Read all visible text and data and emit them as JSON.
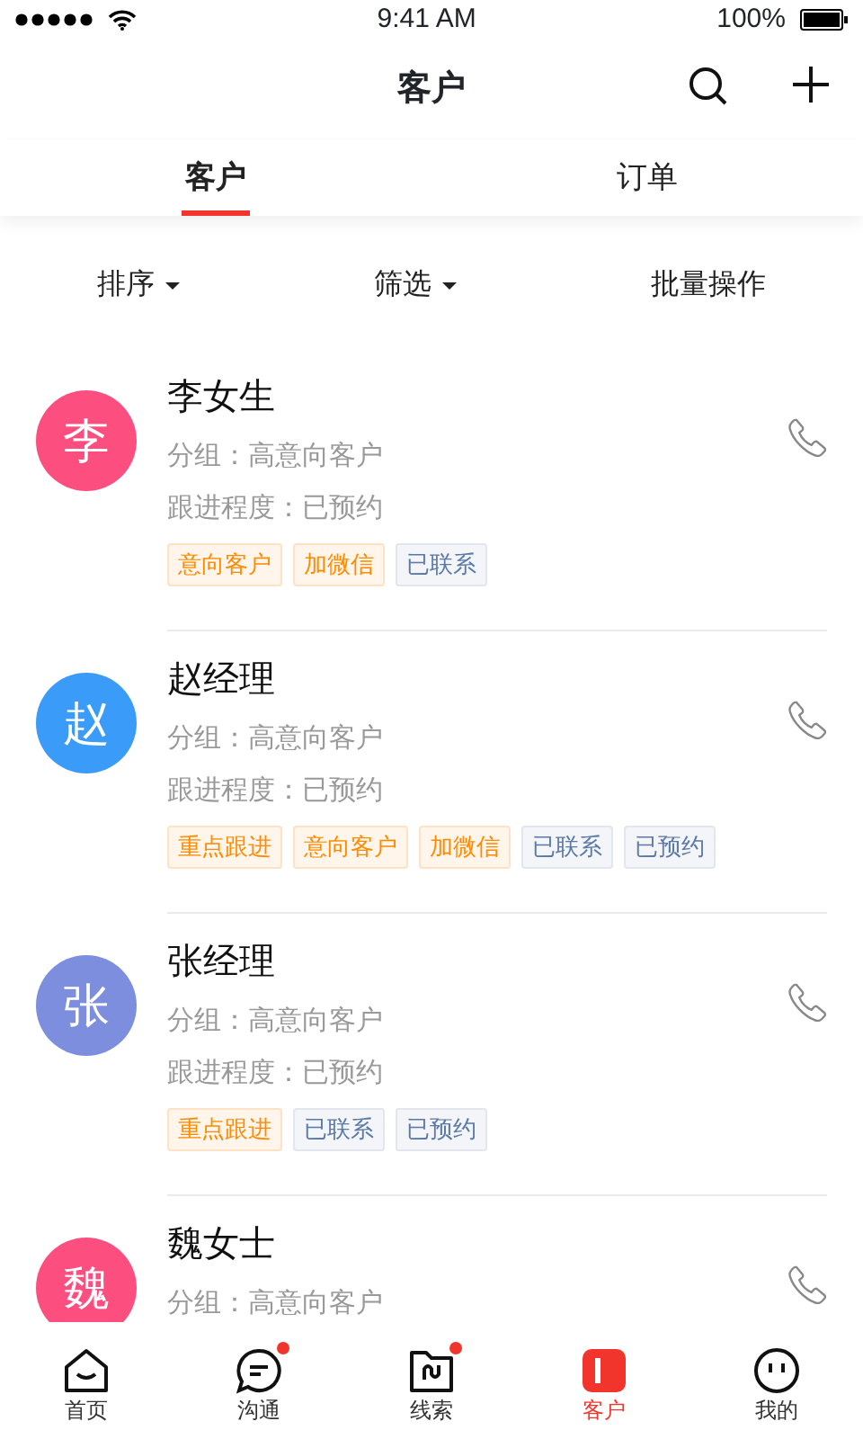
{
  "status_bar": {
    "time": "9:41 AM",
    "battery": "100%"
  },
  "header": {
    "title": "客户"
  },
  "tabs": [
    {
      "label": "客户",
      "selected": true
    },
    {
      "label": "订单",
      "selected": false
    }
  ],
  "filters": [
    {
      "label": "排序",
      "dropdown": true
    },
    {
      "label": "筛选",
      "dropdown": true
    },
    {
      "label": "批量操作",
      "dropdown": false
    }
  ],
  "customers": [
    {
      "avatar": "李",
      "color": "#fc4f7f",
      "name": "李女生",
      "group": "分组：高意向客户",
      "progress": "跟进程度：已预约",
      "tags": [
        {
          "label": "意向客户",
          "kind": "highlight"
        },
        {
          "label": "加微信",
          "kind": "highlight"
        },
        {
          "label": "已联系",
          "kind": "status"
        }
      ]
    },
    {
      "avatar": "赵",
      "color": "#3a9bf8",
      "name": "赵经理",
      "group": "分组：高意向客户",
      "progress": "跟进程度：已预约",
      "tags": [
        {
          "label": "重点跟进",
          "kind": "highlight"
        },
        {
          "label": "意向客户",
          "kind": "highlight"
        },
        {
          "label": "加微信",
          "kind": "highlight"
        },
        {
          "label": "已联系",
          "kind": "status"
        },
        {
          "label": "已预约",
          "kind": "status"
        }
      ]
    },
    {
      "avatar": "张",
      "color": "#7d8ede",
      "name": "张经理",
      "group": "分组：高意向客户",
      "progress": "跟进程度：已预约",
      "tags": [
        {
          "label": "重点跟进",
          "kind": "highlight"
        },
        {
          "label": "已联系",
          "kind": "status"
        },
        {
          "label": "已预约",
          "kind": "status"
        }
      ]
    },
    {
      "avatar": "魏",
      "color": "#fc4f7f",
      "name": "魏女士",
      "group": "分组：高意向客户"
    }
  ],
  "bottom_nav": [
    {
      "label": "首页",
      "kind": "home",
      "selected": false,
      "badge": false
    },
    {
      "label": "沟通",
      "kind": "chat",
      "selected": false,
      "badge": true
    },
    {
      "label": "线索",
      "kind": "leads",
      "selected": false,
      "badge": true
    },
    {
      "label": "客户",
      "kind": "customer",
      "selected": true,
      "badge": false
    },
    {
      "label": "我的",
      "kind": "mine",
      "selected": false,
      "badge": false
    }
  ]
}
